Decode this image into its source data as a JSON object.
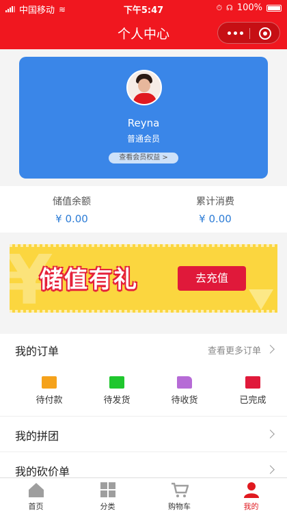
{
  "status_bar": {
    "carrier": "中国移动",
    "time": "下午5:47",
    "battery": "100%"
  },
  "navbar": {
    "title": "个人中心"
  },
  "profile": {
    "name": "Reyna",
    "level": "普通会员",
    "benefit_link": "查看会员权益 >"
  },
  "stats": [
    {
      "label": "储值余额",
      "value": "¥ 0.00"
    },
    {
      "label": "累计消费",
      "value": "¥ 0.00"
    }
  ],
  "banner": {
    "headline": "储值有礼",
    "cta": "去充值"
  },
  "orders": {
    "title": "我的订单",
    "more": "查看更多订单",
    "items": [
      {
        "label": "待付款",
        "color": "#f5a21b",
        "icon": "wallet-icon"
      },
      {
        "label": "待发货",
        "color": "#1fc72e",
        "icon": "wallet-green-icon"
      },
      {
        "label": "待收货",
        "color": "#b66bd6",
        "icon": "truck-icon"
      },
      {
        "label": "已完成",
        "color": "#e0193a",
        "icon": "check-box-icon"
      }
    ]
  },
  "menu": [
    {
      "label": "我的拼团"
    },
    {
      "label": "我的砍价单"
    }
  ],
  "tabbar": {
    "items": [
      {
        "label": "首页",
        "icon": "home-icon"
      },
      {
        "label": "分类",
        "icon": "grid-icon"
      },
      {
        "label": "购物车",
        "icon": "cart-icon"
      },
      {
        "label": "我的",
        "icon": "person-icon",
        "active": true
      }
    ]
  },
  "colors": {
    "brand_red": "#f0171f",
    "card_blue": "#3a86e8",
    "price_blue": "#2c7cd6",
    "banner_yellow": "#fbd63f"
  }
}
